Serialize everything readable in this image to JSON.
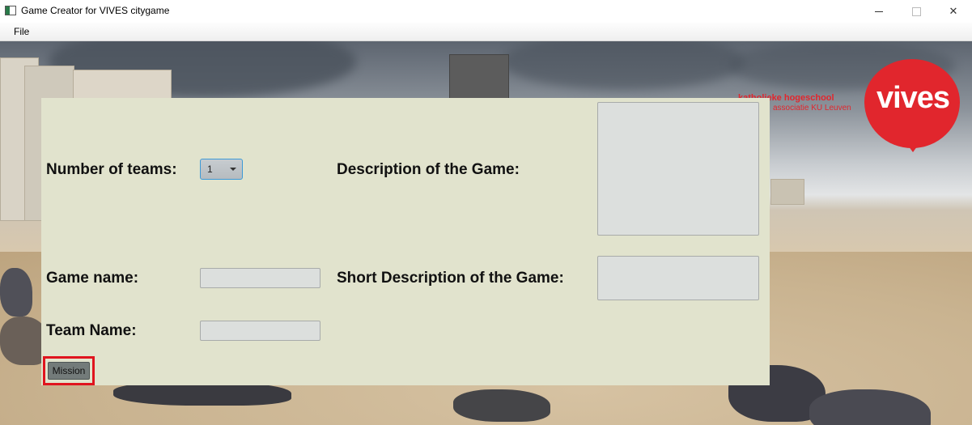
{
  "window": {
    "title": "Game Creator for VIVES citygame",
    "controls": {
      "minimize": "minimize",
      "maximize": "maximize",
      "close": "✕"
    }
  },
  "menu": {
    "file": "File"
  },
  "logo": {
    "line1": "katholieke hogeschool",
    "line2": "associatie KU Leuven",
    "word": "vives",
    "color": "#e1262d"
  },
  "form": {
    "teams_label": "Number of teams:",
    "teams_value": "1",
    "game_name_label": "Game name:",
    "game_name_value": "",
    "team_name_label": "Team Name:",
    "team_name_value": "",
    "description_label": "Description of the Game:",
    "description_value": "",
    "short_description_label": "Short Description of the Game:",
    "short_description_value": "",
    "mission_button": "Mission"
  },
  "colors": {
    "panel": "#e1e3cd",
    "highlight": "#e0141e",
    "focus": "#3d9ad7"
  }
}
